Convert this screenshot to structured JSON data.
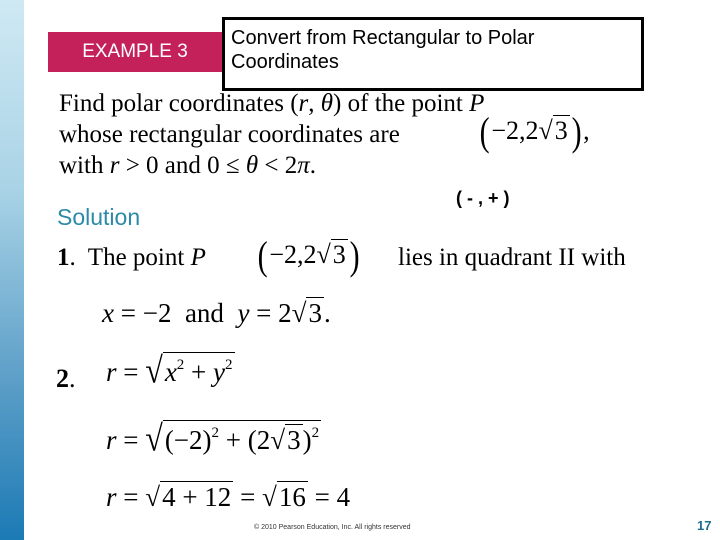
{
  "slide": {
    "badge_label": "EXAMPLE 3",
    "title_line1": "Convert from Rectangular to Polar",
    "title_line2": "Coordinates",
    "problem": {
      "line1_a": "Find polar coordinates (",
      "line1_r": "r",
      "line1_b": ", ",
      "line1_theta": "θ",
      "line1_c": ") of the point ",
      "line1_P": "P",
      "line2": "whose rectangular coordinates are",
      "line2_end": ",",
      "line3_a": "with ",
      "line3_r": "r",
      "line3_b": " > 0 and 0 ≤ ",
      "line3_theta": "θ",
      "line3_c": " < 2",
      "line3_pi": "π",
      "line3_d": "."
    },
    "point": {
      "open": "(",
      "x": "−2,",
      "y_coef": "2",
      "y_rad": "3",
      "close": ")"
    },
    "sign_hint": "( - , + )",
    "solution_label": "Solution",
    "step1": {
      "num": "1",
      "dot": ".",
      "text": "  The point ",
      "P": "P",
      "rest": "lies in quadrant II with"
    },
    "xy_line": {
      "x": "x",
      "x_eq": " = −2  and  ",
      "y": "y",
      "y_eq": " = 2",
      "rad": "3",
      "end": "."
    },
    "step2": {
      "num": "2",
      "dot": ".",
      "eq1": {
        "lhs": "r",
        "eq": " = ",
        "x": "x",
        "plus": " + ",
        "y": "y",
        "exp": "2"
      },
      "eq2": {
        "lhs": "r",
        "eq": " = ",
        "a": "(−2)",
        "plus": " + ",
        "b_open": "(2",
        "b_rad": "3",
        "b_close": ")",
        "exp": "2"
      },
      "eq3": {
        "lhs": "r",
        "eq": " = ",
        "rad1": "4 + 12",
        "mid": " = ",
        "rad2": "16",
        "end": " = 4"
      }
    },
    "footer": "© 2010 Pearson Education, Inc.  All rights reserved",
    "page_number": "17"
  },
  "colors": {
    "badge": "#c4215a",
    "solution": "#2c8aa8",
    "page_number": "#1e6e8e"
  }
}
